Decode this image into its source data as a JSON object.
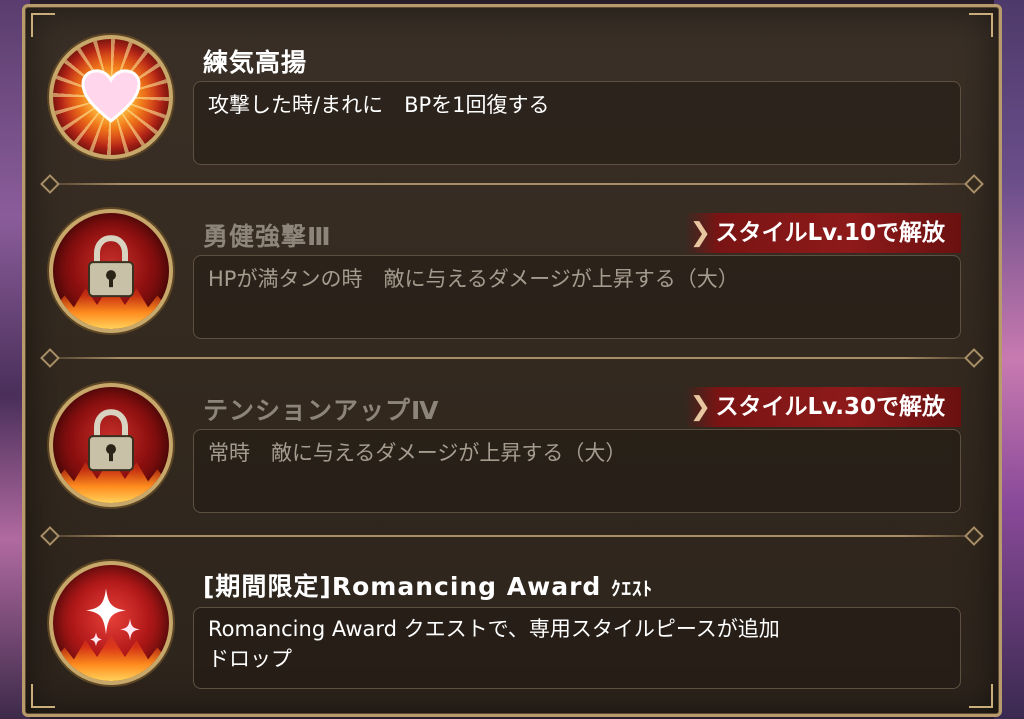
{
  "skills": [
    {
      "title": "練気高揚",
      "description": "攻撃した時/まれに　BPを1回復する",
      "locked": false,
      "icon": "heart-burst-icon"
    },
    {
      "title": "勇健強撃Ⅲ",
      "description": "HPが満タンの時　敵に与えるダメージが上昇する（大）",
      "locked": true,
      "unlock_condition": "スタイルLv.10で解放",
      "icon": "lock-icon"
    },
    {
      "title": "テンションアップⅣ",
      "description": "常時　敵に与えるダメージが上昇する（大）",
      "locked": true,
      "unlock_condition": "スタイルLv.30で解放",
      "icon": "lock-icon"
    },
    {
      "title_main": "[期間限定]Romancing Award",
      "title_suffix": "ｸｴｽﾄ",
      "description_line1": "Romancing Award クエストで、専用スタイルピースが追加",
      "description_line2": "ドロップ",
      "locked": false,
      "icon": "sparkle-icon"
    }
  ],
  "colors": {
    "panel_border": "#b79b6c",
    "badge_red": "#8e1a1a",
    "text_active": "#ffffff",
    "text_dim": "#8e857a"
  }
}
